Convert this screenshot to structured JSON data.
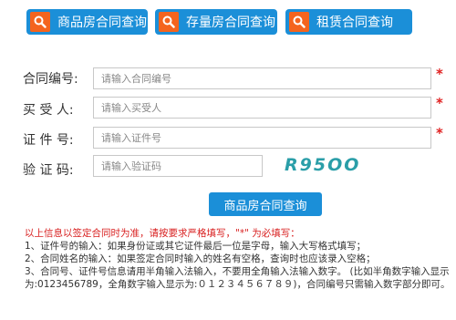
{
  "tabs": [
    {
      "label": "商品房合同查询"
    },
    {
      "label": "存量房合同查询"
    },
    {
      "label": "租赁合同查询"
    }
  ],
  "form": {
    "contract_no": {
      "label": "合同编号:",
      "placeholder": "请输入合同编号",
      "required_mark": "*"
    },
    "buyer": {
      "label": "买 受 人:",
      "placeholder": "请输入买受人",
      "required_mark": "*"
    },
    "id_no": {
      "label": "证 件 号:",
      "placeholder": "请输入证件号",
      "required_mark": "*"
    },
    "captcha": {
      "label": "验 证 码:",
      "placeholder": "请输入验证码",
      "image_text": "R95OO"
    }
  },
  "submit_label": "商品房合同查询",
  "notes": {
    "warning": "以上信息以签定合同时为准，请按要求严格填写，\"*\" 为必填写：",
    "lines": [
      "1、证件号的输入：如果身份证或其它证件最后一位是字母，输入大写格式填写；",
      "2、合同姓名的输入：如果签定合同时输入的姓名有空格，查询时也应该录入空格；",
      "3、合同号、证件号信息请用半角输入法输入，不要用全角输入法输入数字。 (比如半角数字输入显示为:0123456789，全角数字输入显示为:０１２３４５６７８９)，合同编号只需输入数字部分即可。"
    ]
  },
  "colors": {
    "accent": "#1b8fd8",
    "icon_bg": "#f4641e",
    "required": "#e02020",
    "captcha": "#2a9ea8"
  }
}
